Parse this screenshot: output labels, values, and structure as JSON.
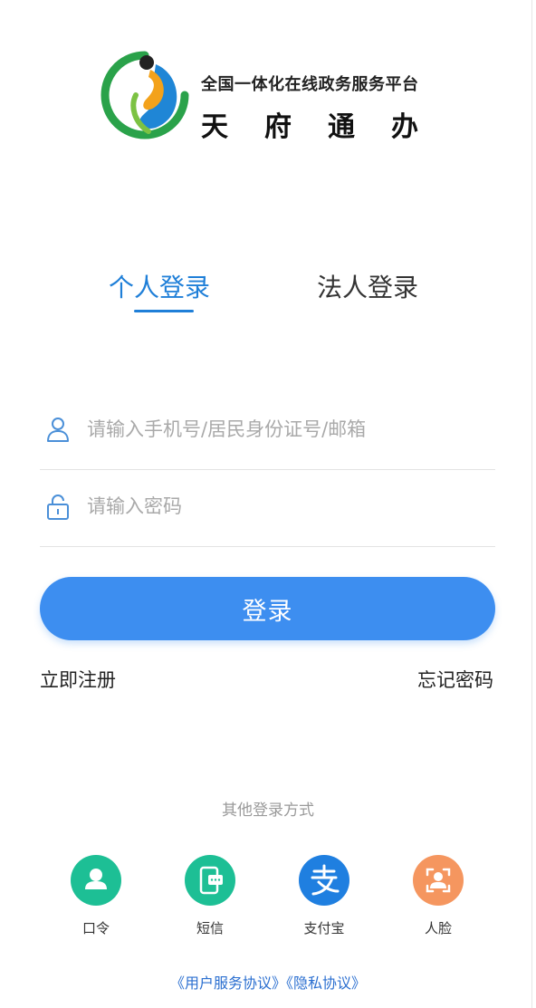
{
  "header": {
    "subtitle": "全国一体化在线政务服务平台",
    "title": "天府通办"
  },
  "tabs": {
    "personal": "个人登录",
    "legal": "法人登录"
  },
  "form": {
    "account_placeholder": "请输入手机号/居民身份证号/邮箱",
    "password_placeholder": "请输入密码",
    "login_label": "登录",
    "register_label": "立即注册",
    "forgot_label": "忘记密码"
  },
  "other_login": {
    "title": "其他登录方式",
    "methods": [
      {
        "label": "口令",
        "icon": "user-icon",
        "color": "#1dbf95"
      },
      {
        "label": "短信",
        "icon": "sms-icon",
        "color": "#1dbf95"
      },
      {
        "label": "支付宝",
        "icon": "alipay-icon",
        "color": "#1f7fe0"
      },
      {
        "label": "人脸",
        "icon": "face-icon",
        "color": "#f5965f"
      }
    ]
  },
  "agreements": {
    "user_service": "《用户服务协议》",
    "privacy": "《隐私协议》"
  },
  "colors": {
    "accent": "#1f7fd8",
    "button": "#3d8ef0"
  }
}
